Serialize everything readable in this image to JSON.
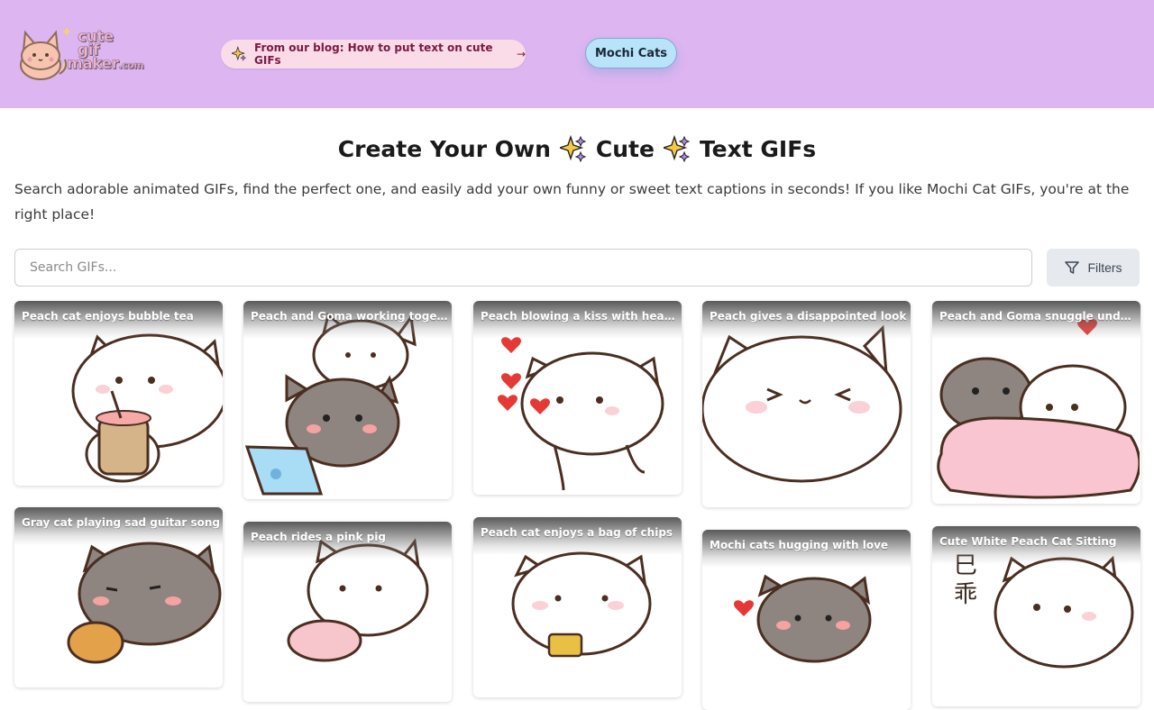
{
  "header": {
    "logo": {
      "line1": "cute",
      "line2": "gif",
      "line3": "maker",
      "suffix": ".com"
    },
    "blog_link": "From our blog: How to put text on cute GIFs",
    "blog_arrow": "→",
    "mochi_button": "Mochi Cats"
  },
  "hero": {
    "title_part1": "Create Your Own",
    "title_part2": "Cute",
    "title_part3": "Text GIFs",
    "description": "Search adorable animated GIFs, find the perfect one, and easily add your own funny or sweet text captions in seconds! If you like Mochi Cat GIFs, you're at the right place!"
  },
  "search": {
    "placeholder": "Search GIFs...",
    "filters_label": "Filters"
  },
  "gifs": [
    {
      "caption": "Peach cat enjoys bubble tea"
    },
    {
      "caption": "Peach and Goma working together"
    },
    {
      "caption": "Peach blowing a kiss with hearts"
    },
    {
      "caption": "Peach gives a disappointed look"
    },
    {
      "caption": "Peach and Goma snuggle under blanket"
    },
    {
      "caption": "Gray cat playing sad guitar song"
    },
    {
      "caption": "Peach rides a pink pig"
    },
    {
      "caption": "Peach cat enjoys a bag of chips"
    },
    {
      "caption": "Mochi cats hugging with love"
    },
    {
      "caption": "Cute White Peach Cat Sitting"
    }
  ],
  "colors": {
    "header_bg": "#dcb5f1",
    "blog_pill_bg": "#fadbe8",
    "mochi_btn_bg": "#b8e3f9"
  }
}
